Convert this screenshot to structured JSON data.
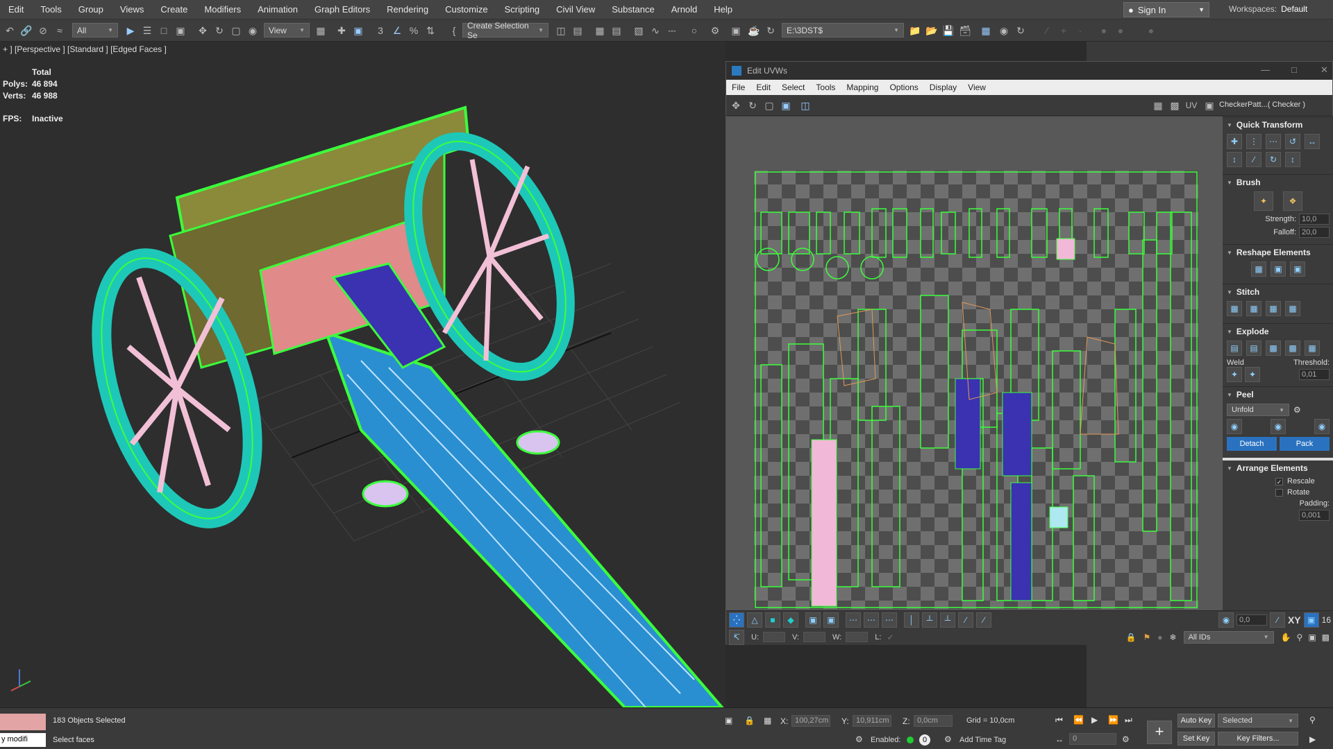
{
  "menubar": {
    "items": [
      "Edit",
      "Tools",
      "Group",
      "Views",
      "Create",
      "Modifiers",
      "Animation",
      "Graph Editors",
      "Rendering",
      "Customize",
      "Scripting",
      "Civil View",
      "Substance",
      "Arnold",
      "Help"
    ],
    "signin": "Sign In",
    "workspaces_label": "Workspaces:",
    "workspaces_value": "Default"
  },
  "toolbar": {
    "filter_value": "All",
    "view_value": "View",
    "selection_set_value": "Create Selection Se",
    "path_value": "E:\\3DST$"
  },
  "viewport": {
    "label": "+ ] [Perspective ] [Standard ] [Edged Faces ]",
    "stats": {
      "total_label": "Total",
      "polys_label": "Polys:",
      "polys_value": "46 894",
      "verts_label": "Verts:",
      "verts_value": "46 988",
      "fps_label": "FPS:",
      "fps_value": "Inactive"
    }
  },
  "uvw_editor": {
    "title": "Edit UVWs",
    "menu": [
      "File",
      "Edit",
      "Select",
      "Tools",
      "Mapping",
      "Options",
      "Display",
      "View"
    ],
    "uv_label": "UV",
    "checker_value": "CheckerPatt...( Checker )",
    "rollouts": {
      "quick_transform": "Quick Transform",
      "brush": "Brush",
      "strength_label": "Strength:",
      "strength_value": "10,0",
      "falloff_label": "Falloff:",
      "falloff_value": "20,0",
      "reshape": "Reshape Elements",
      "stitch": "Stitch",
      "explode": "Explode",
      "weld_label": "Weld",
      "threshold_label": "Threshold:",
      "threshold_value": "0,01",
      "peel": "Peel",
      "unfold_value": "Unfold",
      "detach": "Detach",
      "pack": "Pack",
      "arrange": "Arrange Elements",
      "rescale": "Rescale",
      "rotate": "Rotate",
      "padding_label": "Padding:",
      "padding_value": "0,001"
    },
    "bottom": {
      "spin_value": "0,0",
      "xy_label": "XY",
      "num_value": "16",
      "u_label": "U:",
      "v_label": "V:",
      "w_label": "W:",
      "l_label": "L:",
      "ids_value": "All IDs"
    }
  },
  "statusbar": {
    "modifier_text": "y modifi",
    "objects_selected": "183 Objects Selected",
    "prompt": "Select faces",
    "x_label": "X:",
    "x_value": "100,27cm",
    "y_label": "Y:",
    "y_value": "10,911cm",
    "z_label": "Z:",
    "z_value": "0,0cm",
    "grid": "Grid = 10,0cm",
    "enabled_label": "Enabled:",
    "enabled_value": "0",
    "add_time_tag": "Add Time Tag",
    "auto_key": "Auto Key",
    "selected_value": "Selected",
    "set_key": "Set Key",
    "key_filters": "Key Filters...",
    "frame_value": "0"
  }
}
